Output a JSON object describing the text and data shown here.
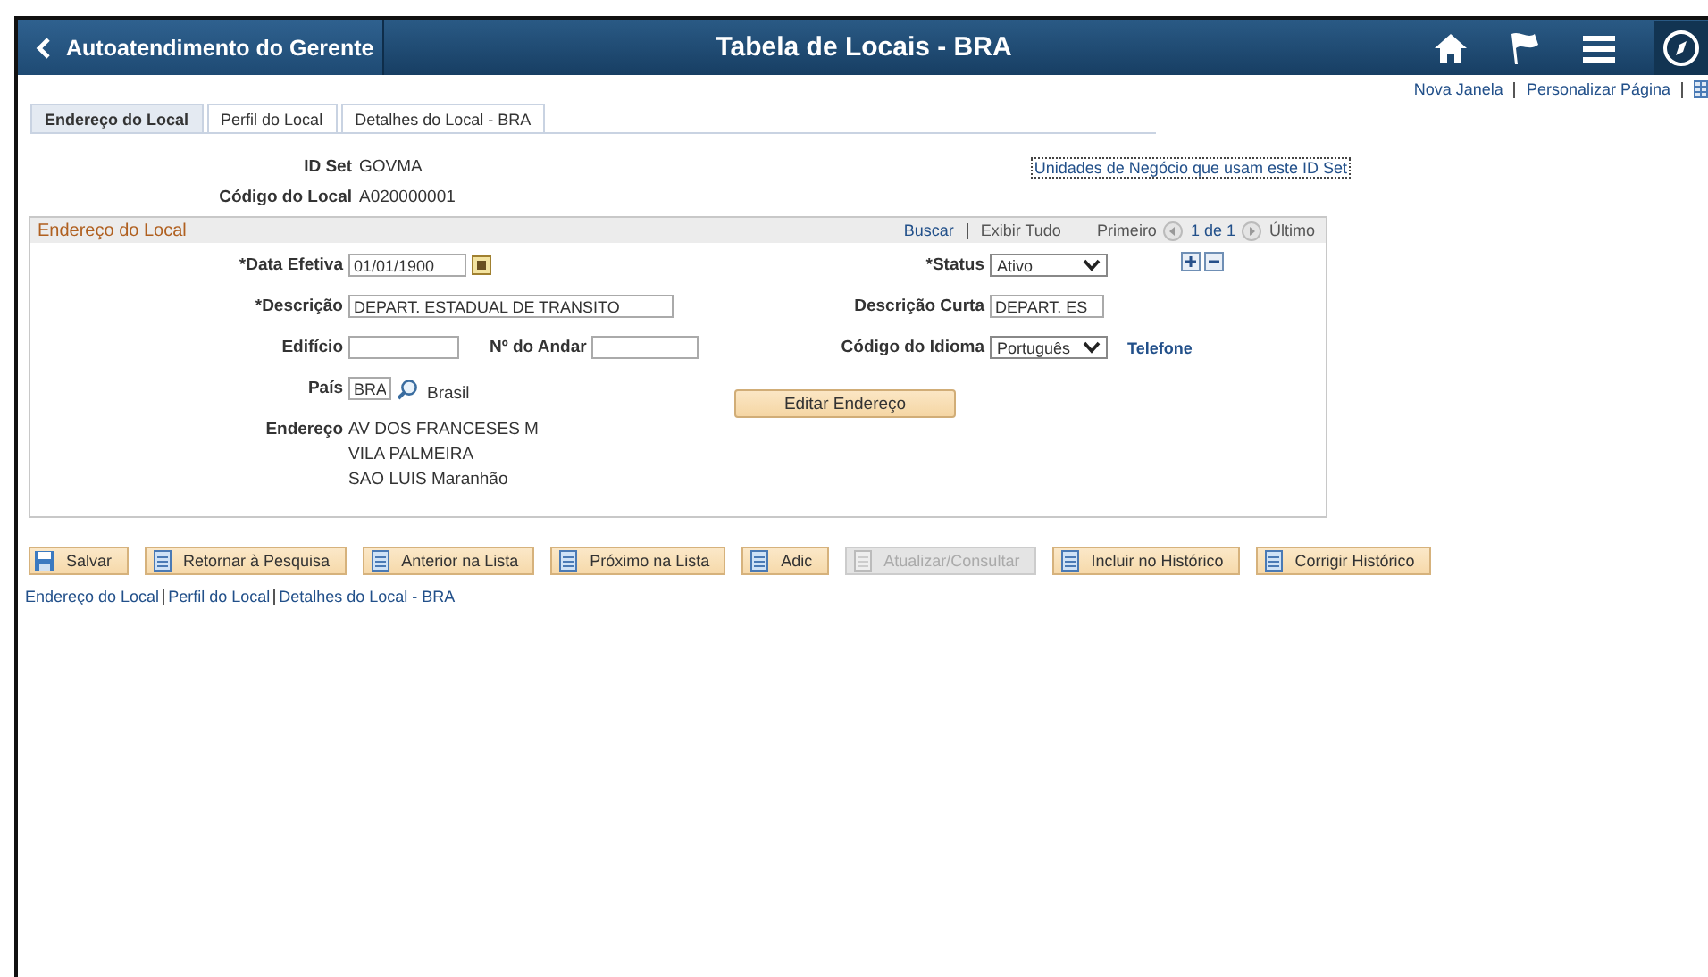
{
  "header": {
    "back_label": "Autoatendimento do Gerente",
    "title": "Tabela de Locais - BRA"
  },
  "top_links": [
    "Nova Janela",
    "Personalizar Página"
  ],
  "tabs": [
    {
      "label": "Endereço do Local",
      "selected": true
    },
    {
      "label": "Perfil do Local",
      "selected": false
    },
    {
      "label": "Detalhes do Local - BRA",
      "selected": false
    }
  ],
  "id_set": {
    "label": "ID Set",
    "value": "GOVMA"
  },
  "location_code": {
    "label": "Código do Local",
    "value": "A020000001"
  },
  "business_units_link": "Unidades de Negócio que usam este ID Set",
  "section": {
    "title": "Endereço do Local",
    "find": "Buscar",
    "view_all": "Exibir Tudo",
    "first": "Primeiro",
    "count": "1 de 1",
    "last": "Último",
    "effective_date": {
      "label": "*Data Efetiva",
      "value": "01/01/1900"
    },
    "status": {
      "label": "*Status",
      "value": "Ativo"
    },
    "description": {
      "label": "*Descrição",
      "value": "DEPART. ESTADUAL DE TRANSITO"
    },
    "short_description": {
      "label": "Descrição Curta",
      "value": "DEPART. ES"
    },
    "building": {
      "label": "Edifício"
    },
    "floor": {
      "label": "Nº do Andar"
    },
    "language": {
      "label": "Código do Idioma",
      "value": "Português"
    },
    "phone_link": "Telefone",
    "country": {
      "label": "País",
      "value": "BRA",
      "name": "Brasil"
    },
    "edit_address": "Editar Endereço",
    "address": {
      "label": "Endereço",
      "lines": [
        "AV DOS FRANCESES M",
        "VILA PALMEIRA",
        "SAO LUIS Maranhão"
      ]
    }
  },
  "toolbar": [
    {
      "label": "Salvar",
      "disabled": false
    },
    {
      "label": "Retornar à Pesquisa",
      "disabled": false
    },
    {
      "label": "Anterior na Lista",
      "disabled": false
    },
    {
      "label": "Próximo na Lista",
      "disabled": false
    },
    {
      "label": "Adic",
      "disabled": false
    },
    {
      "label": "Atualizar/Consultar",
      "disabled": true
    },
    {
      "label": "Incluir no Histórico",
      "disabled": false
    },
    {
      "label": "Corrigir Histórico",
      "disabled": false
    }
  ],
  "bottom_links": [
    "Endereço do Local",
    "Perfil do Local",
    "Detalhes do Local - BRA"
  ]
}
